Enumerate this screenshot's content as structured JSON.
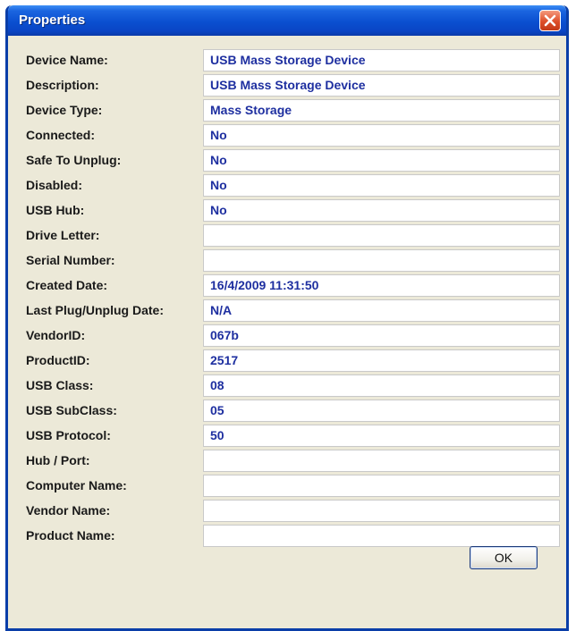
{
  "window": {
    "title": "Properties",
    "close_icon": "close-icon"
  },
  "rows": [
    {
      "label": "Device Name:",
      "value": "USB Mass Storage Device"
    },
    {
      "label": "Description:",
      "value": "USB Mass Storage Device"
    },
    {
      "label": "Device Type:",
      "value": "Mass Storage"
    },
    {
      "label": "Connected:",
      "value": "No"
    },
    {
      "label": "Safe To Unplug:",
      "value": "No"
    },
    {
      "label": "Disabled:",
      "value": "No"
    },
    {
      "label": "USB Hub:",
      "value": "No"
    },
    {
      "label": "Drive Letter:",
      "value": ""
    },
    {
      "label": "Serial Number:",
      "value": ""
    },
    {
      "label": "Created Date:",
      "value": "16/4/2009 11:31:50"
    },
    {
      "label": "Last Plug/Unplug Date:",
      "value": "N/A"
    },
    {
      "label": "VendorID:",
      "value": "067b"
    },
    {
      "label": "ProductID:",
      "value": "2517"
    },
    {
      "label": "USB Class:",
      "value": "08"
    },
    {
      "label": "USB SubClass:",
      "value": "05"
    },
    {
      "label": "USB Protocol:",
      "value": "50"
    },
    {
      "label": "Hub / Port:",
      "value": ""
    },
    {
      "label": "Computer Name:",
      "value": ""
    },
    {
      "label": "Vendor Name:",
      "value": ""
    },
    {
      "label": "Product Name:",
      "value": ""
    }
  ],
  "buttons": {
    "ok_label": "OK"
  },
  "colors": {
    "title_bar": "#0a4fd0",
    "field_text": "#1e2fa0",
    "close_button": "#dd4f2a"
  }
}
